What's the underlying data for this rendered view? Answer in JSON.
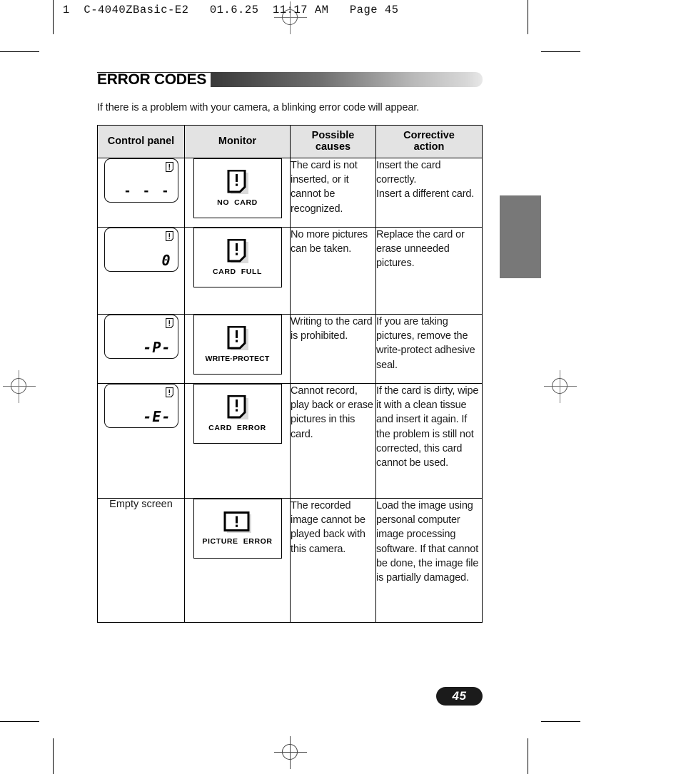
{
  "print_marks": {
    "slug": "1  C-4040ZBasic-E2   01.6.25  11:17 AM   Page 45"
  },
  "heading": {
    "title": "ERROR CODES",
    "intro": "If there is a problem with your camera, a blinking error code will appear."
  },
  "table": {
    "headers": [
      "Control panel",
      "Monitor",
      "Possible\ncauses",
      "Corrective\naction"
    ],
    "headers_line1": [
      "Control panel",
      "Monitor",
      "Possible",
      "Corrective"
    ],
    "headers_line2": [
      "",
      "",
      "causes",
      "action"
    ],
    "rows": [
      {
        "panel_display": "- - -",
        "panel_icon": "memory-card-icon",
        "monitor_icon": "memory-card-icon",
        "monitor_label": "NO  CARD",
        "cause": "The card is not inserted, or it cannot be recognized.",
        "action": "Insert the card correctly.\nInsert a different card."
      },
      {
        "panel_display": "0",
        "panel_icon": "memory-card-icon",
        "monitor_icon": "memory-card-icon",
        "monitor_label": "CARD  FULL",
        "cause": "No more pictures can be taken.",
        "action": "Replace the card or erase unneeded pictures."
      },
      {
        "panel_display": "-P-",
        "panel_icon": "memory-card-icon",
        "monitor_icon": "memory-card-icon",
        "monitor_label": "WRITE·PROTECT",
        "cause": "Writing to the card is prohibited.",
        "action": "If you are taking pictures, remove the write-protect adhesive seal."
      },
      {
        "panel_display": "-E-",
        "panel_icon": "memory-card-icon",
        "monitor_icon": "memory-card-icon",
        "monitor_label": "CARD  ERROR",
        "cause": "Cannot record, play back or erase pictures in this card.",
        "action": "If the card is dirty, wipe it with a clean tissue and insert it again. If the problem is still not corrected, this card cannot be used."
      },
      {
        "panel_display": "Empty screen",
        "panel_icon": "none",
        "monitor_icon": "picture-error-icon",
        "monitor_label": "PICTURE  ERROR",
        "cause": "The recorded image cannot be played back with this camera.",
        "action": "Load the image using personal computer image processing software.  If that cannot be done, the image file is partially damaged."
      }
    ]
  },
  "footer": {
    "page_number": "45"
  },
  "colors": {
    "header_fill": "#e3e3e3",
    "side_tab": "#787878",
    "page_pill": "#1b1b1b",
    "text": "#1a1a1a"
  }
}
